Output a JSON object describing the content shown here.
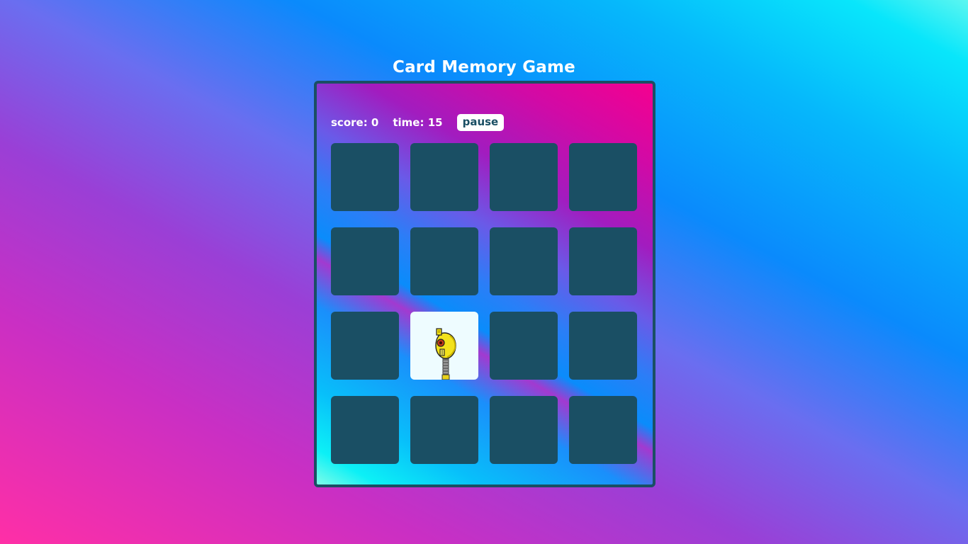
{
  "title": "Card Memory Game",
  "hud": {
    "score_label": "score: 0",
    "time_label": "time: 15",
    "pause_label": "pause"
  },
  "colors": {
    "card_back": "#1a4f64",
    "card_face": "#eefcff",
    "board_border": "#1a4f64",
    "text": "#ffffff"
  },
  "cards": [
    {
      "state": "face-down"
    },
    {
      "state": "face-down"
    },
    {
      "state": "face-down"
    },
    {
      "state": "face-down"
    },
    {
      "state": "face-down"
    },
    {
      "state": "face-down"
    },
    {
      "state": "face-down"
    },
    {
      "state": "face-down"
    },
    {
      "state": "face-down"
    },
    {
      "state": "face-up",
      "icon": "yellow-robot-icon"
    },
    {
      "state": "face-down"
    },
    {
      "state": "face-down"
    },
    {
      "state": "face-down"
    },
    {
      "state": "face-down"
    },
    {
      "state": "face-down"
    },
    {
      "state": "face-down"
    }
  ]
}
